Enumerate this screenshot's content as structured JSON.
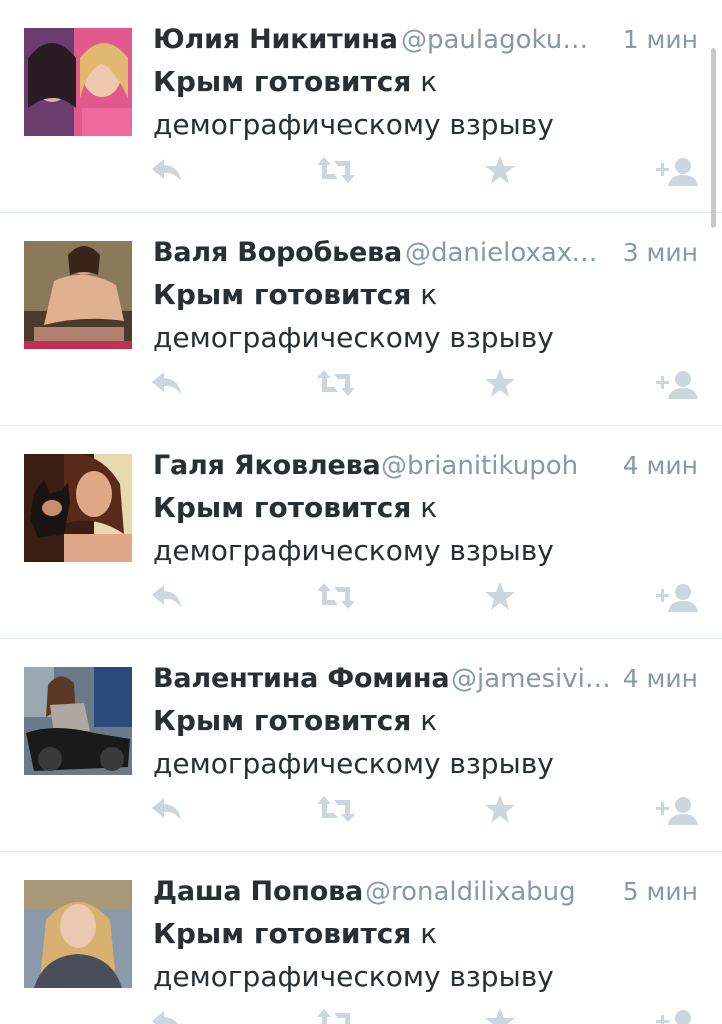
{
  "tweets": [
    {
      "name": "Юлия Никитина",
      "handle": "@paulagokunof",
      "time": "1 мин",
      "text_bold": "Крым готовится",
      "text_rest": " к демографическому взрыву"
    },
    {
      "name": "Валя Воробьева",
      "handle": "@danieloxaxeg...",
      "time": "3 мин",
      "text_bold": "Крым готовится",
      "text_rest": " к демографическому взрыву"
    },
    {
      "name": "Галя Яковлева",
      "handle": "@brianitikupoh",
      "time": "4 мин",
      "text_bold": "Крым готовится",
      "text_rest": " к демографическому взрыву"
    },
    {
      "name": "Валентина Фомина",
      "handle": "@jamesivig...",
      "time": "4 мин",
      "text_bold": "Крым готовится",
      "text_rest": " к демографическому взрыву"
    },
    {
      "name": "Даша Попова",
      "handle": "@ronaldilixabug",
      "time": "5 мин",
      "text_bold": "Крым готовится",
      "text_rest": " к демографическому взрыву"
    }
  ],
  "icons": {
    "reply": "reply-icon",
    "retweet": "retweet-icon",
    "favorite": "favorite-star-icon",
    "follow": "follow-user-icon"
  },
  "colors": {
    "name": "#292f33",
    "secondary": "#8899a6",
    "action_icon": "#ccd6dd",
    "divider": "#e1e8ed"
  }
}
